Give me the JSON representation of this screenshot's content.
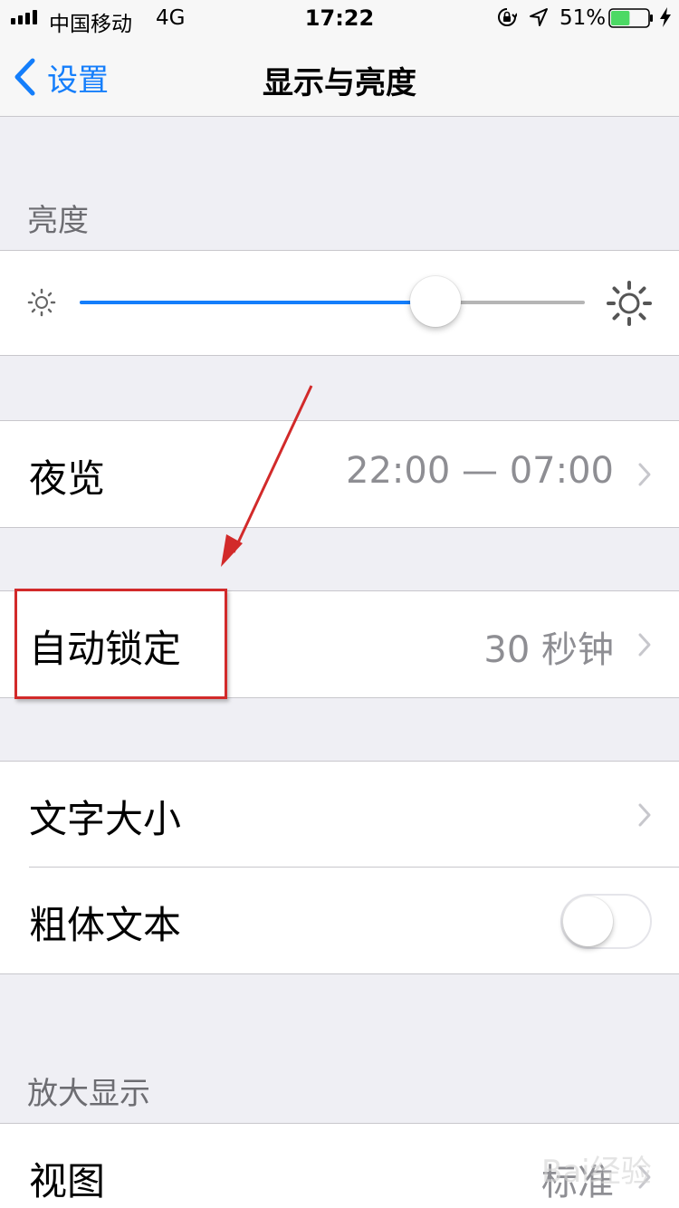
{
  "status_bar": {
    "carrier": "中国移动",
    "network": "4G",
    "time": "17:22",
    "battery_percent": "51%",
    "battery_level": 0.51,
    "battery_color": "#4cd964",
    "icons": [
      "signal-bars-icon",
      "rotation-lock-icon",
      "location-arrow-icon",
      "battery-icon",
      "charging-bolt-icon"
    ]
  },
  "nav": {
    "back_label": "设置",
    "title": "显示与亮度",
    "accent_color": "#147efb"
  },
  "brightness": {
    "header": "亮度",
    "level": 0.705,
    "icons": [
      "sun-small-icon",
      "sun-large-icon"
    ]
  },
  "night_shift": {
    "label": "夜览",
    "value": "22:00 — 07:00"
  },
  "auto_lock": {
    "label": "自动锁定",
    "value": "30 秒钟",
    "highlight_color": "#d22a2a"
  },
  "text": {
    "text_size_label": "文字大小",
    "bold_text_label": "粗体文本",
    "bold_text_on": false
  },
  "zoom": {
    "header": "放大显示",
    "view_label": "视图",
    "view_value": "标准"
  },
  "watermark": "Bai经验"
}
